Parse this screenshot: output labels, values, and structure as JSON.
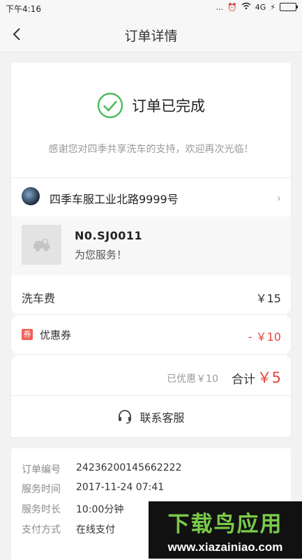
{
  "status_bar": {
    "time": "下午4:16",
    "network": "4G",
    "dots": "..."
  },
  "nav": {
    "title": "订单详情"
  },
  "order_status": {
    "text": "订单已完成",
    "thanks": "感谢您对四季共享洗车的支持，欢迎再次光临！",
    "accent": "#4cbb5a"
  },
  "store": {
    "name": "四季车服工业北路9999号"
  },
  "service": {
    "number": "N0.SJ0011",
    "message": "为您服务！"
  },
  "fees": {
    "wash_label": "洗车费",
    "wash_value": "￥15",
    "coupon_badge": "券",
    "coupon_label": "优惠券",
    "coupon_value": "- ￥10",
    "saved": "已优惠￥10",
    "total_label": "合计",
    "total_value": "￥5"
  },
  "contact": {
    "label": "联系客服"
  },
  "order_info": [
    {
      "key": "订单编号",
      "value": "24236200145662222"
    },
    {
      "key": "服务时间",
      "value": "2017-11-24 07:41"
    },
    {
      "key": "服务时长",
      "value": "10:00分钟"
    },
    {
      "key": "支付方式",
      "value": "在线支付"
    }
  ],
  "watermark": {
    "logo": "下载鸟应用",
    "url": "www.xiazainiao.com"
  },
  "colors": {
    "price_red": "#e64340",
    "coupon_badge": "#f0605a",
    "success_green": "#4cbb5a"
  }
}
